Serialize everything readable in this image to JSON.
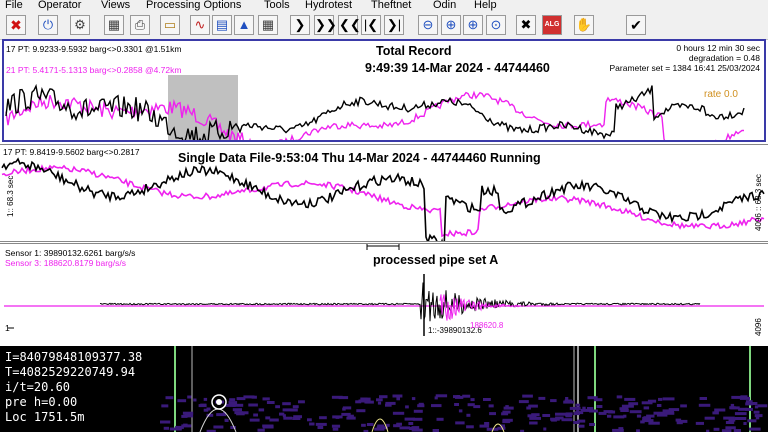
{
  "menu": [
    "File",
    "Operator",
    "Views",
    "Processing Options",
    "Tools",
    "Hydrotest",
    "Theftnet",
    "Odin",
    "Help"
  ],
  "toolbar": [
    {
      "icon": "close-icon",
      "glyph": "✖",
      "color": "#d01010"
    },
    {
      "icon": "power-icon",
      "glyph": "⏻",
      "color": "#2050c0"
    },
    {
      "icon": "tool-icon",
      "glyph": "⚙",
      "color": "#404040"
    },
    {
      "icon": "calculator-icon",
      "glyph": "▦",
      "color": "#404040"
    },
    {
      "icon": "printer-icon",
      "glyph": "⎙",
      "color": "#404040"
    },
    {
      "icon": "open-folder-icon",
      "glyph": "▭",
      "color": "#b08020"
    },
    {
      "icon": "waveform-icon",
      "glyph": "∿",
      "color": "#c02020"
    },
    {
      "icon": "signal-chart-icon",
      "glyph": "▤",
      "color": "#2050c0"
    },
    {
      "icon": "ship-icon",
      "glyph": "▲",
      "color": "#2050c0"
    },
    {
      "icon": "grid-icon",
      "glyph": "▦",
      "color": "#404040"
    },
    {
      "icon": "next-icon",
      "glyph": "❯",
      "color": "#000"
    },
    {
      "icon": "fast-forward-icon",
      "glyph": "❯❯",
      "color": "#000"
    },
    {
      "icon": "rewind-icon",
      "glyph": "❮❮",
      "color": "#000"
    },
    {
      "icon": "first-icon",
      "glyph": "|❮",
      "color": "#000"
    },
    {
      "icon": "last-icon",
      "glyph": "❯|",
      "color": "#000"
    },
    {
      "icon": "zoom-out-icon",
      "glyph": "⊖",
      "color": "#2050c0"
    },
    {
      "icon": "zoom-in-icon",
      "glyph": "⊕",
      "color": "#2050c0"
    },
    {
      "icon": "zoom-fit-icon",
      "glyph": "⊕",
      "color": "#2050c0"
    },
    {
      "icon": "zoom-reset-icon",
      "glyph": "⊙",
      "color": "#2050c0"
    },
    {
      "icon": "cross-icon",
      "glyph": "✖",
      "color": "#000"
    },
    {
      "icon": "alarm-icon",
      "glyph": "ALG",
      "color": "#fff"
    },
    {
      "icon": "hand-icon",
      "glyph": "✋",
      "color": "#d0a000"
    },
    {
      "icon": "checkmark-icon",
      "glyph": "✔",
      "color": "#000"
    }
  ],
  "panel1": {
    "stat_black": "17 PT: 9.9233-9.5932  barg<>0.3301  @1.51km",
    "stat_magenta": "21 PT: 5.4171-5.1313  barg<>0.2858  @4.72km",
    "title": "Total Record",
    "subtitle": "9:49:39 14-Mar 2024 - 44744460",
    "elapsed": "0 hours 12 min 30 sec",
    "degradation": "degradation = 0.48",
    "parameter_set": "Parameter set = 1384 16:41 25/03/2024",
    "overlay_label": "rate 0.0"
  },
  "panel2": {
    "stat_black": "17 PT: 9.8419-9.5602  barg<>0.2817",
    "title": "Single Data File-9:53:04  Thu 14-Mar 2024 - 44744460 Running",
    "left_axis": "1:: 68.3 sec",
    "right_axis": "4096 :: 68.3 sec"
  },
  "panel3": {
    "sensor1": "Sensor 1: 39890132.6261 barg/s/s",
    "sensor3": "Sensor 3: 188620.8179 barg/s/s",
    "title": "processed pipe set A",
    "marker_black": "1::-39890132.6",
    "marker_magenta": "188620.8",
    "left_tick": "1",
    "right_axis": "4096"
  },
  "panel4": {
    "lines": [
      "I=84079848109377.38",
      "T=4082529220749.94",
      "i/t=20.60",
      "pre h=0.00",
      "Loc 1751.5m"
    ]
  },
  "colors": {
    "black_trace": "#000000",
    "magenta_trace": "#ee22ee",
    "frame_blue": "#3a3aa8"
  }
}
